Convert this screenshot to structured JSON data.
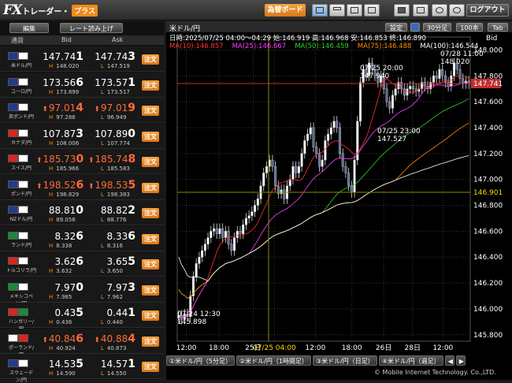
{
  "app": {
    "logo_fx": "FX",
    "logo_trader": "トレーダー・",
    "logo_plus": "プラス",
    "trade_board": "為替ボード",
    "logout": "ログアウト"
  },
  "left": {
    "edit": "編集",
    "rate_read": "レート読み上げ",
    "col_pair": "通貨",
    "col_bid": "Bid",
    "col_ask": "Ask"
  },
  "pairs": [
    {
      "name": "米ドル/円",
      "bid_pre": "147.74",
      "bid_last": "1",
      "ask_pre": "147.74",
      "ask_last": "3",
      "high": "148.020",
      "low": "147.519",
      "up": false,
      "c1": "#1e3c8c",
      "c2": "#ffffff"
    },
    {
      "name": "ユーロ/円",
      "bid_pre": "173.56",
      "bid_last": "6",
      "ask_pre": "173.57",
      "ask_last": "1",
      "high": "173.899",
      "low": "173.517",
      "up": false,
      "c1": "#1e3c8c",
      "c2": "#ffffff"
    },
    {
      "name": "英ポンド/円",
      "bid_pre": "97.01",
      "bid_last": "4",
      "ask_pre": "97.01",
      "ask_last": "9",
      "high": "97.286",
      "low": "96.949",
      "up": true,
      "c1": "#1e3c8c",
      "c2": "#ffffff"
    },
    {
      "name": "カナダ/円",
      "bid_pre": "107.87",
      "bid_last": "3",
      "ask_pre": "107.89",
      "ask_last": "0",
      "high": "108.006",
      "low": "107.774",
      "up": false,
      "c1": "#d22",
      "c2": "#ffffff"
    },
    {
      "name": "スイス/円",
      "bid_pre": "185.73",
      "bid_last": "0",
      "ask_pre": "185.74",
      "ask_last": "8",
      "high": "185.966",
      "low": "185.583",
      "up": true,
      "c1": "#d22",
      "c2": "#ffffff"
    },
    {
      "name": "ポンド/円",
      "bid_pre": "198.52",
      "bid_last": "6",
      "ask_pre": "198.53",
      "ask_last": "5",
      "high": "198.829",
      "low": "198.383",
      "up": true,
      "c1": "#1e3c8c",
      "c2": "#ffffff"
    },
    {
      "name": "NZドル/円",
      "bid_pre": "88.81",
      "bid_last": "0",
      "ask_pre": "88.82",
      "ask_last": "2",
      "high": "89.058",
      "low": "88.776",
      "up": false,
      "c1": "#1e3c8c",
      "c2": "#ffffff"
    },
    {
      "name": "ランド/円",
      "bid_pre": "8.32",
      "bid_last": "6",
      "ask_pre": "8.33",
      "ask_last": "6",
      "high": "8.338",
      "low": "8.316",
      "up": false,
      "c1": "#1a8a3a",
      "c2": "#ffffff"
    },
    {
      "name": "トルコリラ/円",
      "bid_pre": "3.62",
      "bid_last": "6",
      "ask_pre": "3.65",
      "ask_last": "5",
      "high": "3.632",
      "low": "3.650",
      "up": false,
      "c1": "#d22",
      "c2": "#ffffff"
    },
    {
      "name": "メキシコペソ/円",
      "bid_pre": "7.97",
      "bid_last": "0",
      "ask_pre": "7.97",
      "ask_last": "3",
      "high": "7.985",
      "low": "7.962",
      "up": false,
      "c1": "#1a8a3a",
      "c2": "#ffffff"
    },
    {
      "name": "ハンガリー/円",
      "bid_pre": "0.43",
      "bid_last": "5",
      "ask_pre": "0.44",
      "ask_last": "1",
      "high": "0.436",
      "low": "0.440",
      "up": false,
      "c1": "#d22",
      "c2": "#1a8a3a"
    },
    {
      "name": "ポーランド/円",
      "bid_pre": "40.84",
      "bid_last": "6",
      "ask_pre": "40.88",
      "ask_last": "4",
      "high": "40.924",
      "low": "40.873",
      "up": true,
      "c1": "#ffffff",
      "c2": "#d22"
    },
    {
      "name": "スウェーデン/円",
      "bid_pre": "14.53",
      "bid_last": "5",
      "ask_pre": "14.57",
      "ask_last": "1",
      "high": "14.590",
      "low": "14.550",
      "up": false,
      "c1": "#1e3c8c",
      "c2": "#ffffff"
    }
  ],
  "order_label": "注文",
  "chart": {
    "title": "米ドル/円",
    "setting": "設定",
    "interval": "30分足",
    "count": "100本",
    "tab": "Tab",
    "info": "日時:2025/07/25 04:00～04:29 始:146.919 高:146.968 安:146.853 終:146.890",
    "ma": [
      {
        "label": "MA(10):146.857",
        "color": "#ff3030"
      },
      {
        "label": "MA(25):146.667",
        "color": "#ff40ff"
      },
      {
        "label": "MA(50):146.459",
        "color": "#30d030"
      },
      {
        "label": "MA(75):146.488",
        "color": "#ff8c00"
      },
      {
        "label": "MA(100):146.544",
        "color": "#ffffff"
      }
    ],
    "bid_label": "Bid",
    "yticks": [
      "148.000",
      "147.800",
      "147.600",
      "147.400",
      "147.200",
      "147.000",
      "146.800",
      "146.600",
      "146.400",
      "146.200",
      "146.000",
      "145.800"
    ],
    "current": "147.741",
    "marker": "146.901",
    "xticks": [
      "12:00",
      "18:00",
      "25日",
      "07/25 04:00",
      "12:00",
      "18:00",
      "26日",
      "28日",
      "12:00"
    ],
    "ann": [
      {
        "date": "07/25 20:00",
        "val": "147.940"
      },
      {
        "date": "07/28 11:00",
        "val": "148.020"
      },
      {
        "date": "07/25 23:00",
        "val": "147.527"
      },
      {
        "date": "07/24 12:30",
        "val": "145.898"
      }
    ],
    "tabs": [
      "①米ドル/円（5分足）",
      "②米ドル/円（1時間足）",
      "③米ドル/円（日足）",
      "④米ドル/円（週足）"
    ],
    "copyright": "© Mobile Internet Technology. Co.,LTD."
  },
  "chart_data": {
    "type": "candlestick",
    "x": [
      "07/24 11:00",
      "07/24 11:30",
      "07/24 12:00",
      "07/24 12:30",
      "07/24 13:00",
      "07/24 13:30",
      "07/24 14:00",
      "07/24 14:30",
      "07/24 15:00",
      "07/24 15:30",
      "07/24 16:00",
      "07/24 16:30",
      "07/24 17:00",
      "07/24 17:30",
      "07/24 18:00",
      "07/24 18:30",
      "07/24 19:00",
      "07/24 19:30",
      "07/24 20:00",
      "07/24 20:30",
      "07/24 21:00",
      "07/24 21:30",
      "07/24 22:00",
      "07/24 22:30",
      "07/24 23:00",
      "07/24 23:30",
      "07/25 00:00",
      "07/25 00:30",
      "07/25 01:00",
      "07/25 01:30",
      "07/25 02:00",
      "07/25 02:30",
      "07/25 03:00",
      "07/25 03:30",
      "07/25 04:00",
      "07/25 04:30",
      "07/25 05:00",
      "07/25 05:30",
      "07/25 06:00",
      "07/25 06:30",
      "07/25 07:00",
      "07/25 07:30",
      "07/25 08:00",
      "07/25 08:30",
      "07/25 09:00",
      "07/25 09:30",
      "07/25 10:00",
      "07/25 10:30",
      "07/25 11:00",
      "07/25 11:30",
      "07/25 12:00",
      "07/25 12:30",
      "07/25 13:00",
      "07/25 13:30",
      "07/25 14:00",
      "07/25 14:30",
      "07/25 15:00",
      "07/25 15:30",
      "07/25 16:00",
      "07/25 16:30",
      "07/25 17:00",
      "07/25 17:30",
      "07/25 18:00",
      "07/25 18:30",
      "07/25 19:00",
      "07/25 19:30",
      "07/25 20:00",
      "07/25 20:30",
      "07/25 21:00",
      "07/25 21:30",
      "07/25 22:00",
      "07/25 22:30",
      "07/25 23:00",
      "07/25 23:30",
      "07/26 00:00",
      "07/26 00:30",
      "07/26 01:00",
      "07/26 01:30",
      "07/26 02:00",
      "07/26 02:30",
      "07/26 03:00",
      "07/26 03:30",
      "07/26 04:00",
      "07/26 04:30",
      "07/26 05:00",
      "07/26 05:30",
      "07/28 07:00",
      "07/28 07:30",
      "07/28 08:00",
      "07/28 08:30",
      "07/28 09:00",
      "07/28 09:30",
      "07/28 10:00",
      "07/28 10:30",
      "07/28 11:00",
      "07/28 11:30",
      "07/28 12:00",
      "07/28 12:30",
      "07/28 13:00",
      "07/28 13:30"
    ],
    "close": [
      145.95,
      145.92,
      145.96,
      145.94,
      146.1,
      146.25,
      146.35,
      146.4,
      146.45,
      146.5,
      146.55,
      146.6,
      146.62,
      146.58,
      146.62,
      146.55,
      146.6,
      146.5,
      146.45,
      146.55,
      146.6,
      146.58,
      146.65,
      146.7,
      146.72,
      146.75,
      146.8,
      146.85,
      146.95,
      147.05,
      147.1,
      147.15,
      147.1,
      146.95,
      146.89,
      146.92,
      146.85,
      146.95,
      147.0,
      147.1,
      147.05,
      147.1,
      147.2,
      147.3,
      147.35,
      147.4,
      147.25,
      147.2,
      147.1,
      147.15,
      147.3,
      147.35,
      147.4,
      147.45,
      147.4,
      147.2,
      147.1,
      147.05,
      146.95,
      146.9,
      147.15,
      147.45,
      147.75,
      147.85,
      147.8,
      147.9,
      147.85,
      147.8,
      147.75,
      147.8,
      147.7,
      147.6,
      147.55,
      147.65,
      147.7,
      147.75,
      147.7,
      147.65,
      147.7,
      147.72,
      147.7,
      147.68,
      147.7,
      147.75,
      147.72,
      147.7,
      147.75,
      147.8,
      147.78,
      147.85,
      147.8,
      147.75,
      147.72,
      147.8,
      147.9,
      147.85,
      147.78,
      147.74,
      147.76,
      147.74
    ],
    "ylim": [
      145.75,
      148.1
    ]
  }
}
